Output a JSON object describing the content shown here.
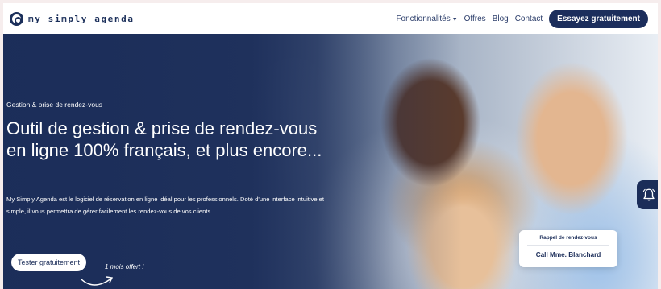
{
  "nav": {
    "logo_text": "my simply agenda",
    "items": [
      {
        "label": "Fonctionnalités",
        "has_dropdown": true
      },
      {
        "label": "Offres"
      },
      {
        "label": "Blog"
      },
      {
        "label": "Contact"
      }
    ],
    "cta_label": "Essayez gratuitement"
  },
  "hero": {
    "eyebrow": "Gestion & prise de rendez-vous",
    "headline": "Outil de gestion & prise de rendez-vous en ligne 100% français, et plus encore...",
    "description": "My Simply Agenda est le logiciel de réservation en ligne idéal pour les professionnels. Doté d'une interface intuitive et simple, il vous permettra de gérer facilement les rendez-vous de vos clients.",
    "cta_label": "Tester gratuitement",
    "note": "1 mois offert !"
  },
  "reminder": {
    "title": "Rappel de rendez-vous",
    "body": "Call Mme. Blanchard"
  },
  "icons": {
    "logo": "logo-icon",
    "bell": "bell-icon",
    "caret": "chevron-down-icon",
    "arrow": "curved-arrow-icon"
  },
  "colors": {
    "brand_navy": "#1b2d59",
    "nav_bg": "#ffffff",
    "page_bg": "#f6eded"
  }
}
